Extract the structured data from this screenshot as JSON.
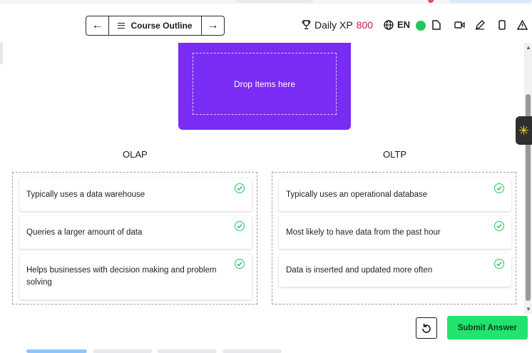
{
  "header": {
    "course_outline_label": "Course Outline",
    "prev_arrow": "←",
    "next_arrow": "→",
    "daily_xp_label": "Daily XP",
    "daily_xp_value": "800",
    "language": "EN"
  },
  "drop_zone": {
    "placeholder": "Drop Items here"
  },
  "columns": [
    {
      "title": "OLAP",
      "items": [
        "Typically uses a data warehouse",
        "Queries a larger amount of data",
        "Helps businesses with decision making and problem solving"
      ]
    },
    {
      "title": "OLTP",
      "items": [
        "Typically uses an operational database",
        "Most likely to have data from the past hour",
        "Data is inserted and updated more often"
      ]
    }
  ],
  "actions": {
    "submit_label": "Submit Answer",
    "reset_icon": "reset-icon"
  },
  "colors": {
    "drop_zone_bg": "#7a2cf4",
    "submit_bg": "#22e36c",
    "correct_check": "#22c55e",
    "xp_value": "#c2185b"
  }
}
